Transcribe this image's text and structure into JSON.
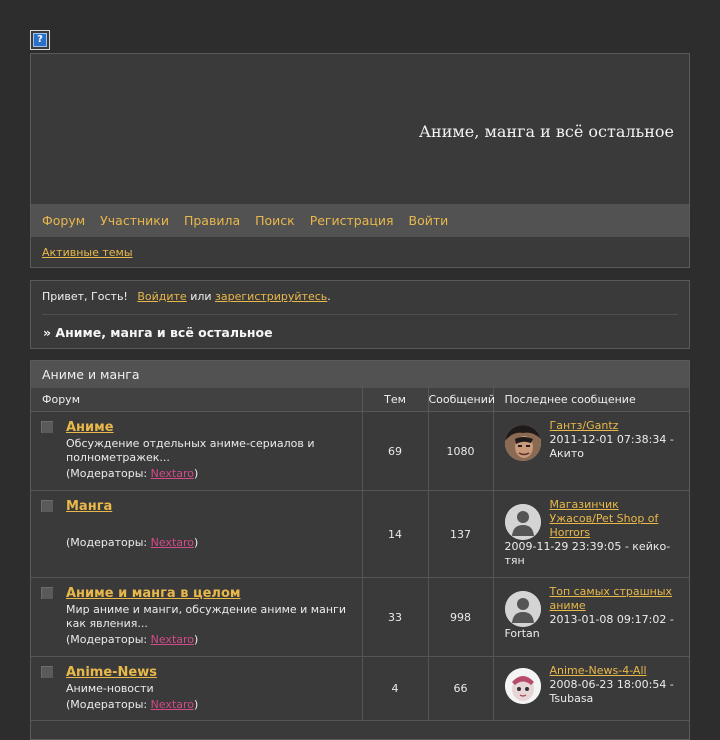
{
  "header": {
    "help_icon": "question-icon",
    "site_title": "Аниме, манга и всё остальное"
  },
  "nav": {
    "items": [
      "Форум",
      "Участники",
      "Правила",
      "Поиск",
      "Регистрация",
      "Войти"
    ],
    "active_topics": "Активные темы"
  },
  "welcome": {
    "greeting": "Привет, Гость!",
    "login": "Войдите",
    "or": "или",
    "register": "зарегистрируйтесь",
    "dot": ".",
    "breadcrumb": "» Аниме, манга и всё остальное"
  },
  "category": {
    "title": "Аниме и манга",
    "columns": {
      "forum": "Форум",
      "topics": "Тем",
      "posts": "Сообщений",
      "last_post": "Последнее сообщение"
    },
    "mods_prefix": "(Модераторы: ",
    "mods_suffix": ")",
    "forums": [
      {
        "title": "Аниме",
        "description": "Обсуждение отдельных аниме-сериалов и полнометражек...",
        "moderator": "Nextaro",
        "topics": "69",
        "posts": "1080",
        "last_title": "Гантз/Gantz",
        "last_meta": "2011-12-01 07:38:34 - Акито",
        "avatar": "character-avatar"
      },
      {
        "title": "Манга",
        "description": "",
        "moderator": "Nextaro",
        "topics": "14",
        "posts": "137",
        "last_title": "Магазинчик Ужасов/Pet Shop of Horrors",
        "last_meta": "2009-11-29 23:39:05 - кейко-тян",
        "avatar": "default-user-avatar"
      },
      {
        "title": "Аниме и манга в целом",
        "description": "Мир аниме и манги, обсуждение аниме и манги как явления...",
        "moderator": "Nextaro",
        "topics": "33",
        "posts": "998",
        "last_title": "Топ самых страшных аниме",
        "last_meta": "2013-01-08 09:17:02 - Fortan",
        "avatar": "default-user-avatar"
      },
      {
        "title": "Anime-News",
        "description": "Аниме-новости",
        "moderator": "Nextaro",
        "topics": "4",
        "posts": "66",
        "last_title": "Anime-News-4-All",
        "last_meta": "2008-06-23 18:00:54 - Tsubasa",
        "avatar": "character-avatar"
      }
    ]
  }
}
